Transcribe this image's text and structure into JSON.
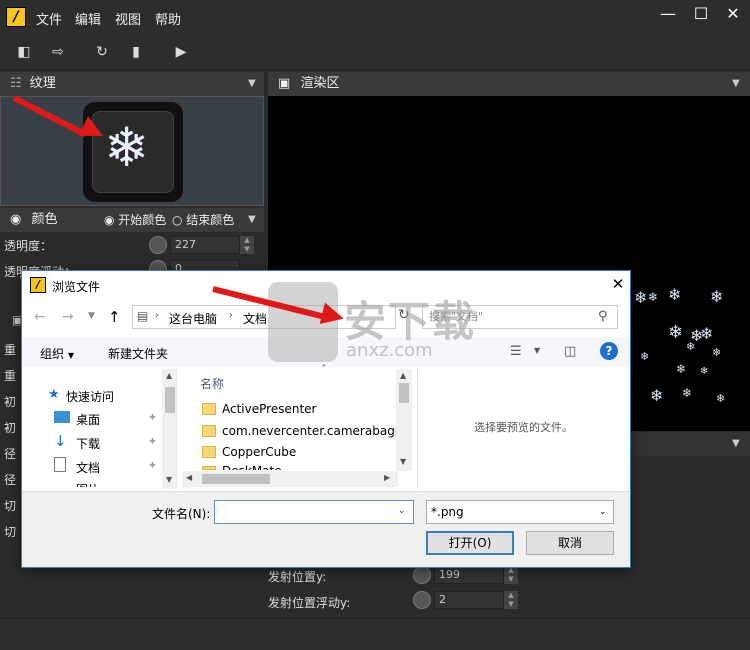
{
  "app": {
    "logo_glyph": "/",
    "menus": [
      "文件",
      "编辑",
      "视图",
      "帮助"
    ],
    "window_controls": {
      "minimize": "—",
      "maximize": "☐",
      "close": "✕"
    }
  },
  "toolbar": {
    "icons": [
      "new-project-icon",
      "export-icon",
      "refresh-icon",
      "frame-icon",
      "play-icon"
    ]
  },
  "texture_panel": {
    "title": "纹理",
    "icon": "snowflake-icon"
  },
  "render_panel": {
    "title": "渲染区"
  },
  "color_panel": {
    "title": "颜色",
    "start_color": "开始颜色",
    "end_color": "结束颜色"
  },
  "properties": [
    {
      "label": "透明度：",
      "value": "227"
    },
    {
      "label": "透明度浮动：",
      "value": "0"
    },
    {
      "label": "发射位置y:",
      "value": "199"
    },
    {
      "label": "发射位置浮动y:",
      "value": "2"
    }
  ],
  "left_partial_labels": [
    "重",
    "重",
    "初",
    "初",
    "径",
    "径",
    "切",
    "切"
  ],
  "dialog": {
    "title": "浏览文件",
    "address": [
      "这台电脑",
      "文档"
    ],
    "search_placeholder": "搜索\"文档\"",
    "organize": "组织",
    "new_folder": "新建文件夹",
    "nav_items": [
      "快速访问",
      "桌面",
      "下载",
      "文档",
      "图片"
    ],
    "column_header": "名称",
    "files": [
      "ActivePresenter",
      "com.nevercenter.camerabagp",
      "CopperCube",
      "DeskMate..."
    ],
    "preview_text": "选择要预览的文件。",
    "filename_label": "文件名(N):",
    "filename_value": "",
    "filetype": "*.png",
    "open_button": "打开(O)",
    "cancel_button": "取消"
  },
  "watermark": {
    "text": "安下载",
    "sub": "anxz.com"
  },
  "colors": {
    "accent": "#e01818",
    "dialog_border": "#3b7bbf",
    "folder": "#f8d775"
  }
}
